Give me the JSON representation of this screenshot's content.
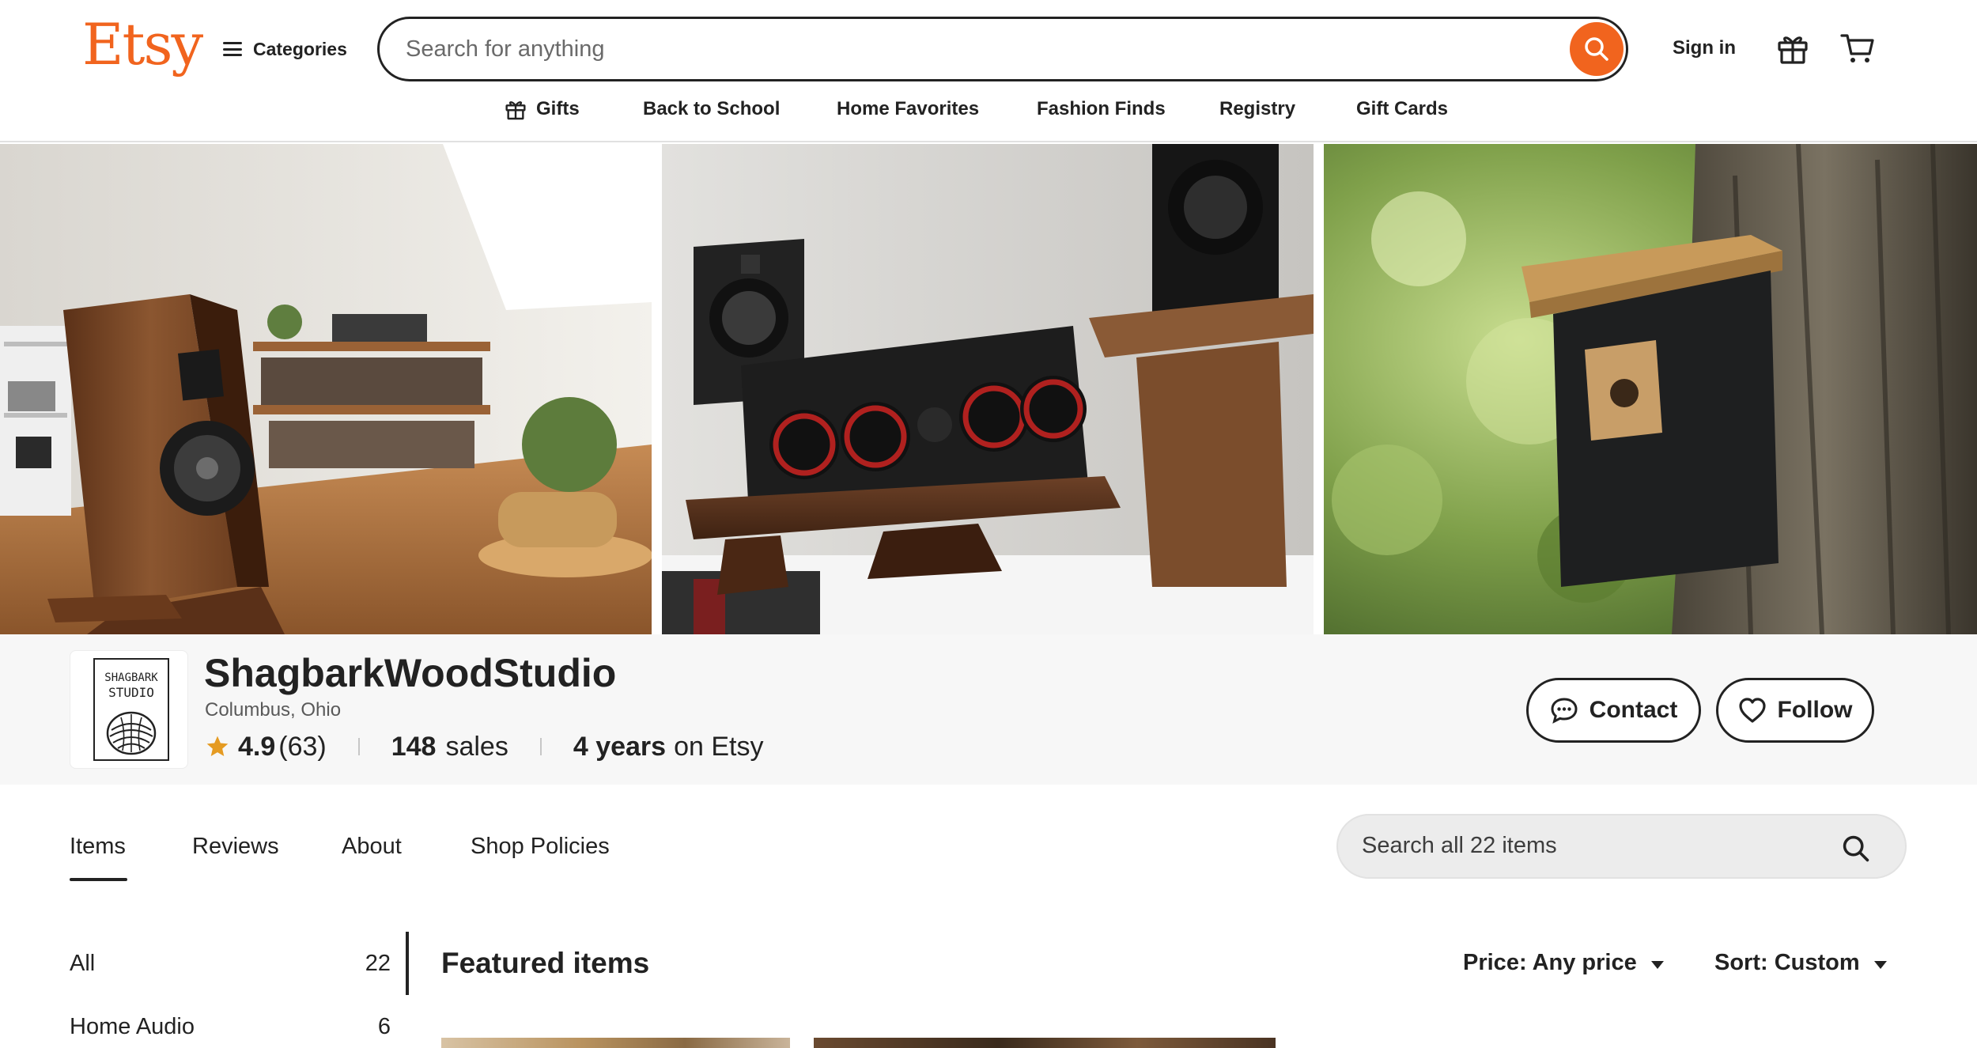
{
  "header": {
    "logo": "Etsy",
    "categories_label": "Categories",
    "search_placeholder": "Search for anything",
    "signin_label": "Sign in"
  },
  "nav": {
    "items": [
      "Gifts",
      "Back to School",
      "Home Favorites",
      "Fashion Finds",
      "Registry",
      "Gift Cards"
    ]
  },
  "shop": {
    "name": "ShagbarkWoodStudio",
    "location": "Columbus, Ohio",
    "rating": "4.9",
    "review_count": "(63)",
    "sales_number": "148",
    "sales_label": "sales",
    "years_number": "4 years",
    "years_label": "on Etsy",
    "logo_text_line1": "SHAGBARK",
    "logo_text_line2": "STUDIO",
    "contact_label": "Contact",
    "follow_label": "Follow"
  },
  "tabs": {
    "items": [
      "Items",
      "Reviews",
      "About",
      "Shop Policies"
    ],
    "active": "Items",
    "search_placeholder": "Search all 22 items"
  },
  "sidebar": {
    "sections": [
      {
        "label": "All",
        "count": "22"
      },
      {
        "label": "Home Audio",
        "count": "6"
      }
    ]
  },
  "main": {
    "heading": "Featured items",
    "price_filter": "Price: Any price",
    "sort_filter": "Sort: Custom"
  },
  "colors": {
    "brand": "#f1641e",
    "text": "#222222",
    "star": "#e59b22"
  }
}
